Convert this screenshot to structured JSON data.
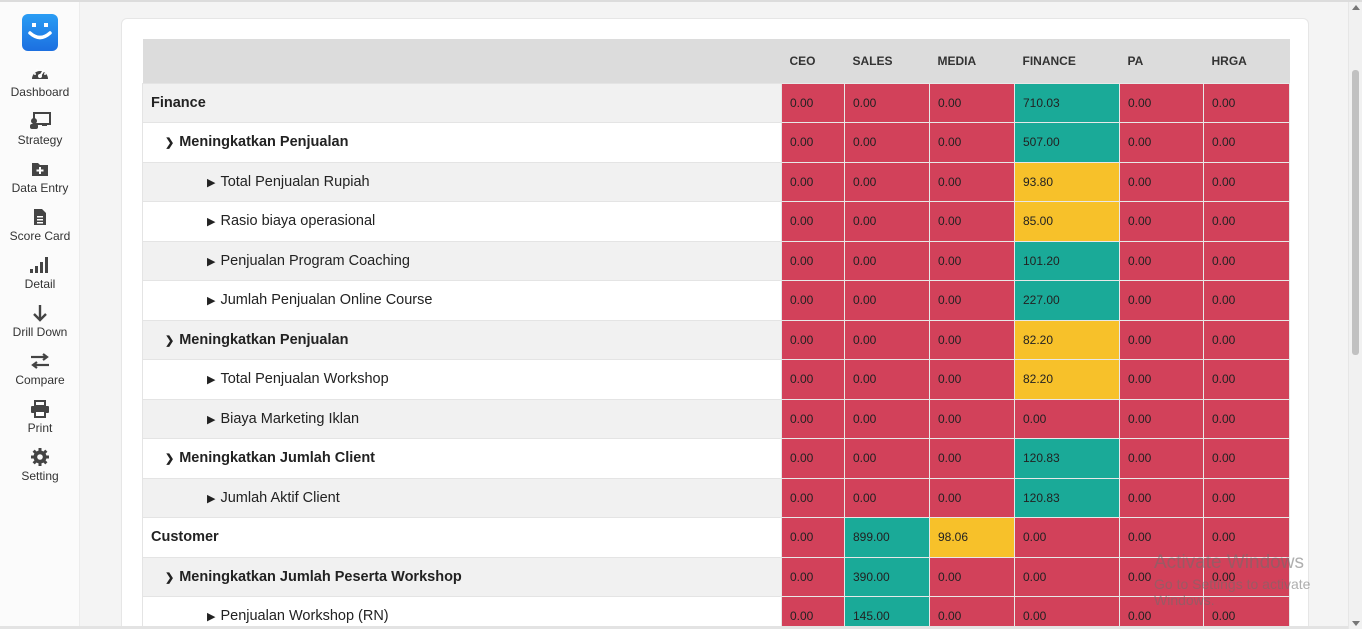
{
  "sidebar": {
    "items": [
      {
        "label": "Dashboard",
        "icon": "speedometer-icon"
      },
      {
        "label": "Strategy",
        "icon": "presentation-icon"
      },
      {
        "label": "Data Entry",
        "icon": "folder-plus-icon"
      },
      {
        "label": "Score Card",
        "icon": "document-icon"
      },
      {
        "label": "Detail",
        "icon": "signal-bars-icon"
      },
      {
        "label": "Drill Down",
        "icon": "arrow-down-icon"
      },
      {
        "label": "Compare",
        "icon": "swap-arrows-icon"
      },
      {
        "label": "Print",
        "icon": "printer-icon"
      },
      {
        "label": "Setting",
        "icon": "gear-icon"
      }
    ]
  },
  "table": {
    "columns": [
      "CEO",
      "SALES",
      "MEDIA",
      "FINANCE",
      "PA",
      "HRGA"
    ],
    "colors": {
      "red": "#d2415a",
      "green": "#1aaa98",
      "yellow": "#f7c12a"
    },
    "rows": [
      {
        "label": "Finance",
        "level": 0,
        "values": [
          "0.00",
          "0.00",
          "0.00",
          "710.03",
          "0.00",
          "0.00"
        ],
        "status": [
          "red",
          "red",
          "red",
          "green",
          "red",
          "red"
        ]
      },
      {
        "label": "Meningkatkan Penjualan",
        "level": 1,
        "values": [
          "0.00",
          "0.00",
          "0.00",
          "507.00",
          "0.00",
          "0.00"
        ],
        "status": [
          "red",
          "red",
          "red",
          "green",
          "red",
          "red"
        ]
      },
      {
        "label": "Total Penjualan Rupiah",
        "level": 2,
        "values": [
          "0.00",
          "0.00",
          "0.00",
          "93.80",
          "0.00",
          "0.00"
        ],
        "status": [
          "red",
          "red",
          "red",
          "yellow",
          "red",
          "red"
        ]
      },
      {
        "label": "Rasio biaya operasional",
        "level": 2,
        "values": [
          "0.00",
          "0.00",
          "0.00",
          "85.00",
          "0.00",
          "0.00"
        ],
        "status": [
          "red",
          "red",
          "red",
          "yellow",
          "red",
          "red"
        ]
      },
      {
        "label": "Penjualan Program Coaching",
        "level": 2,
        "values": [
          "0.00",
          "0.00",
          "0.00",
          "101.20",
          "0.00",
          "0.00"
        ],
        "status": [
          "red",
          "red",
          "red",
          "green",
          "red",
          "red"
        ]
      },
      {
        "label": "Jumlah Penjualan Online Course",
        "level": 2,
        "values": [
          "0.00",
          "0.00",
          "0.00",
          "227.00",
          "0.00",
          "0.00"
        ],
        "status": [
          "red",
          "red",
          "red",
          "green",
          "red",
          "red"
        ]
      },
      {
        "label": "Meningkatkan Penjualan",
        "level": 1,
        "values": [
          "0.00",
          "0.00",
          "0.00",
          "82.20",
          "0.00",
          "0.00"
        ],
        "status": [
          "red",
          "red",
          "red",
          "yellow",
          "red",
          "red"
        ]
      },
      {
        "label": "Total Penjualan Workshop",
        "level": 2,
        "values": [
          "0.00",
          "0.00",
          "0.00",
          "82.20",
          "0.00",
          "0.00"
        ],
        "status": [
          "red",
          "red",
          "red",
          "yellow",
          "red",
          "red"
        ]
      },
      {
        "label": "Biaya Marketing Iklan",
        "level": 2,
        "values": [
          "0.00",
          "0.00",
          "0.00",
          "0.00",
          "0.00",
          "0.00"
        ],
        "status": [
          "red",
          "red",
          "red",
          "red",
          "red",
          "red"
        ]
      },
      {
        "label": "Meningkatkan Jumlah Client",
        "level": 1,
        "values": [
          "0.00",
          "0.00",
          "0.00",
          "120.83",
          "0.00",
          "0.00"
        ],
        "status": [
          "red",
          "red",
          "red",
          "green",
          "red",
          "red"
        ]
      },
      {
        "label": "Jumlah Aktif Client",
        "level": 2,
        "values": [
          "0.00",
          "0.00",
          "0.00",
          "120.83",
          "0.00",
          "0.00"
        ],
        "status": [
          "red",
          "red",
          "red",
          "green",
          "red",
          "red"
        ]
      },
      {
        "label": "Customer",
        "level": 0,
        "values": [
          "0.00",
          "899.00",
          "98.06",
          "0.00",
          "0.00",
          "0.00"
        ],
        "status": [
          "red",
          "green",
          "yellow",
          "red",
          "red",
          "red"
        ]
      },
      {
        "label": "Meningkatkan Jumlah Peserta Workshop",
        "level": 1,
        "values": [
          "0.00",
          "390.00",
          "0.00",
          "0.00",
          "0.00",
          "0.00"
        ],
        "status": [
          "red",
          "green",
          "red",
          "red",
          "red",
          "red"
        ]
      },
      {
        "label": "Penjualan Workshop (RN)",
        "level": 2,
        "values": [
          "0.00",
          "145.00",
          "0.00",
          "0.00",
          "0.00",
          "0.00"
        ],
        "status": [
          "red",
          "green",
          "red",
          "red",
          "red",
          "red"
        ]
      }
    ]
  },
  "watermark": {
    "line1": "Activate Windows",
    "line2": "Go to Settings to activate Windows."
  }
}
